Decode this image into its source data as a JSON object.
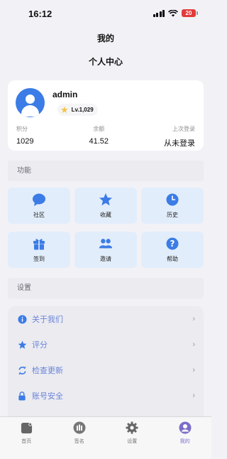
{
  "status": {
    "time": "16:12",
    "battery": "20"
  },
  "header": {
    "title": "我的",
    "subtitle": "个人中心"
  },
  "profile": {
    "username": "admin",
    "level": "Lv.1,029",
    "stats": [
      {
        "label": "积分",
        "value": "1029"
      },
      {
        "label": "余额",
        "value": "41.52"
      },
      {
        "label": "上次登录",
        "value": "从未登录"
      }
    ]
  },
  "functions": {
    "title": "功能",
    "items": [
      {
        "label": "社区",
        "icon": "chat-bubble-icon"
      },
      {
        "label": "收藏",
        "icon": "star-icon"
      },
      {
        "label": "历史",
        "icon": "clock-icon"
      },
      {
        "label": "签到",
        "icon": "gift-icon"
      },
      {
        "label": "邀请",
        "icon": "people-icon"
      },
      {
        "label": "帮助",
        "icon": "help-icon"
      }
    ]
  },
  "settings": {
    "title": "设置",
    "items": [
      {
        "label": "关于我们",
        "icon": "info-icon"
      },
      {
        "label": "评分",
        "icon": "star-icon"
      },
      {
        "label": "检查更新",
        "icon": "refresh-icon"
      },
      {
        "label": "账号安全",
        "icon": "lock-icon"
      }
    ]
  },
  "tabs": [
    {
      "label": "首页",
      "icon": "home-icon"
    },
    {
      "label": "签名",
      "icon": "signature-icon"
    },
    {
      "label": "设置",
      "icon": "gear-icon"
    },
    {
      "label": "我的",
      "icon": "person-icon",
      "active": true
    }
  ],
  "colors": {
    "accent": "#3b7ce6",
    "tile_bg": "#e2edfb",
    "link_text": "#6b84d9",
    "tab_active": "#7b6ec8"
  }
}
